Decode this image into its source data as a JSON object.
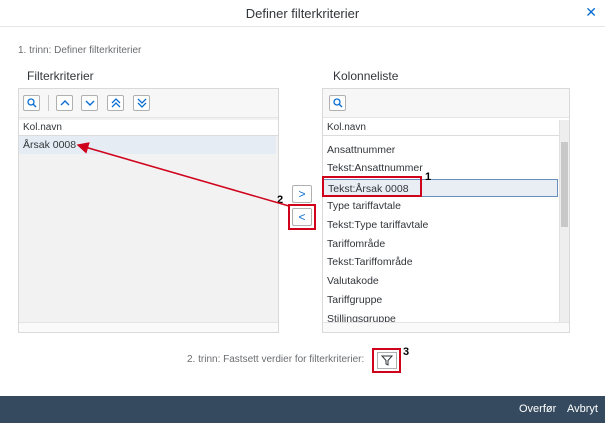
{
  "dialog": {
    "title": "Definer filterkriterier",
    "close_label": "✕"
  },
  "step1": "1. trinn: Definer filterkriterier",
  "left_panel": {
    "title": "Filterkriterier",
    "column_header": "Kol.navn",
    "items": [
      "Årsak 0008"
    ]
  },
  "right_panel": {
    "title": "Kolonneliste",
    "column_header": "Kol.navn",
    "items": [
      "Ansattnummer",
      "Tekst:Ansattnummer",
      "Tekst:Årsak 0008",
      "Type tariffavtale",
      "Tekst:Type tariffavtale",
      "Tariffområde",
      "Tekst:Tariffområde",
      "Valutakode",
      "Tariffgruppe",
      "Stillingsgruppe"
    ]
  },
  "move_buttons": {
    "add": ">",
    "remove": "<"
  },
  "step2": "2. trinn: Fastsett verdier for filterkriterier:",
  "annotations": [
    "1",
    "2",
    "3"
  ],
  "footer": {
    "transfer": "Overfør",
    "cancel": "Avbryt"
  },
  "colors": {
    "accent": "#0a6ed1",
    "footer_bg": "#354a5f",
    "annotation": "#d0021b"
  },
  "icons": [
    "close-icon",
    "search-icon",
    "chevron-up-icon",
    "chevron-down-icon",
    "double-chevron-up-icon",
    "double-chevron-down-icon",
    "filter-icon"
  ]
}
